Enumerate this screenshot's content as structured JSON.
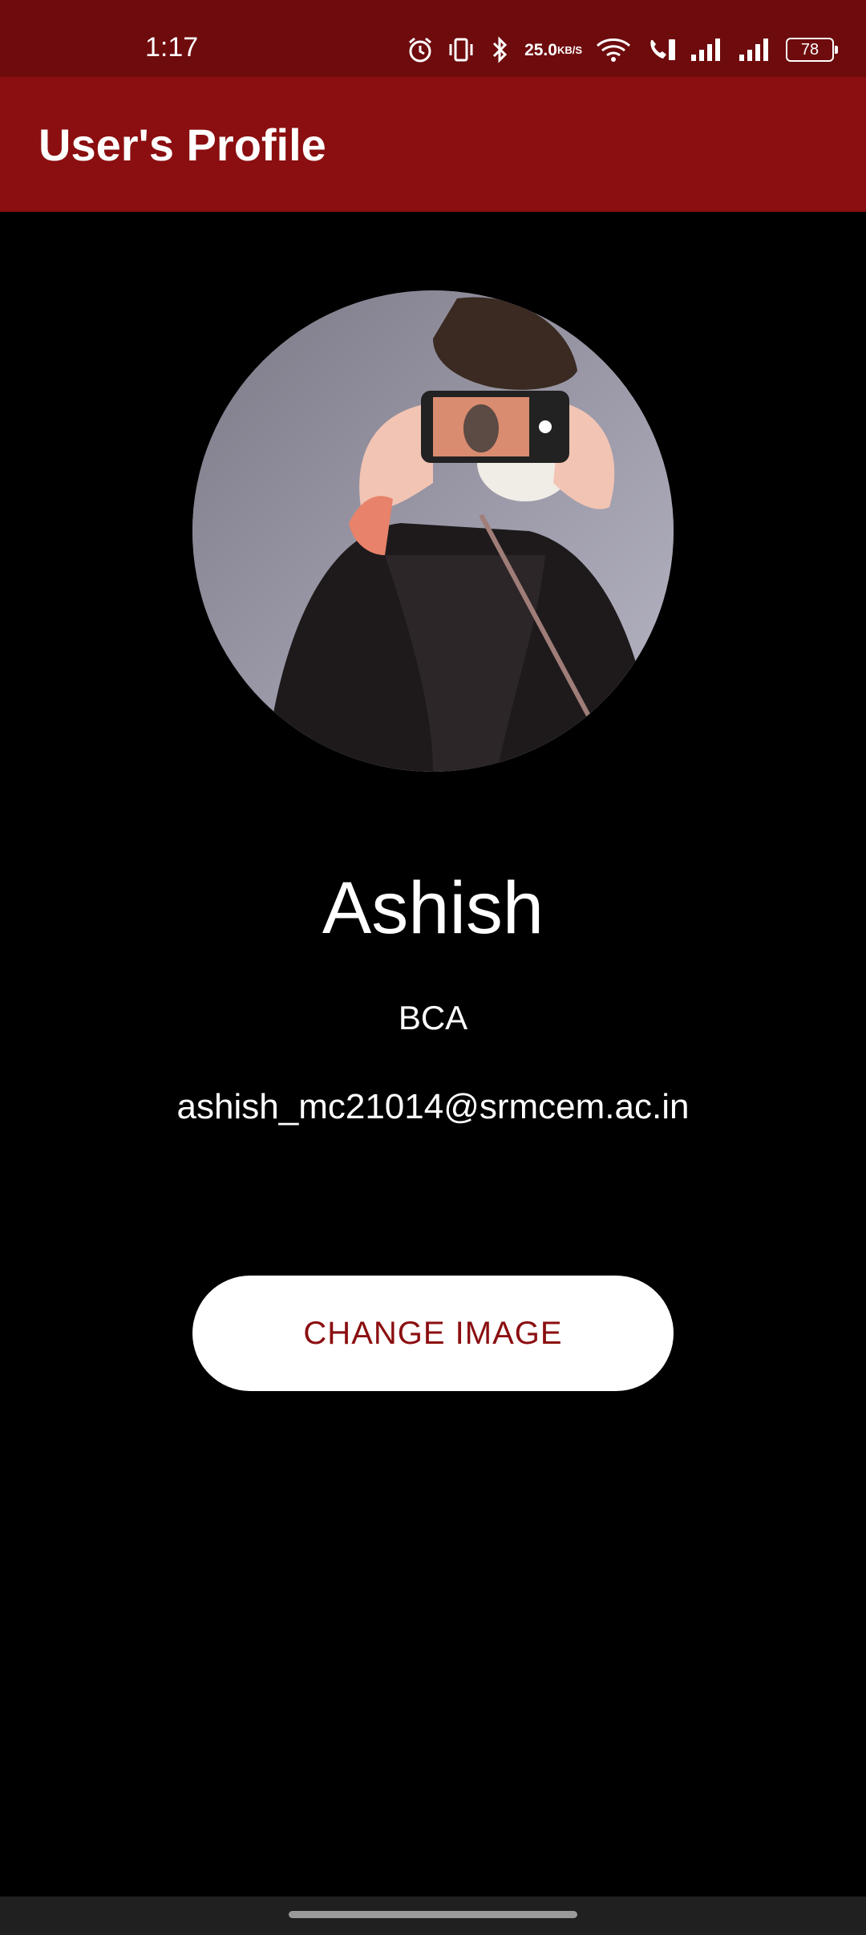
{
  "status_bar": {
    "time": "1:17",
    "net_speed_value": "25.0",
    "net_speed_unit": "KB/S",
    "battery": "78",
    "background_color": "#6e0b0d",
    "icons": [
      "alarm-icon",
      "vibrate-icon",
      "bluetooth-icon",
      "wifi-icon",
      "vowifi-call-icon",
      "signal-icon",
      "signal-icon"
    ]
  },
  "app_bar": {
    "title": "User's Profile",
    "color": "#8b0e10"
  },
  "profile": {
    "avatar": "profile-photo",
    "name": "Ashish",
    "course": "BCA",
    "email": "ashish_mc21014@srmcem.ac.in"
  },
  "actions": {
    "change_image_label": "CHANGE IMAGE",
    "button_text_color": "#8b0e10"
  }
}
